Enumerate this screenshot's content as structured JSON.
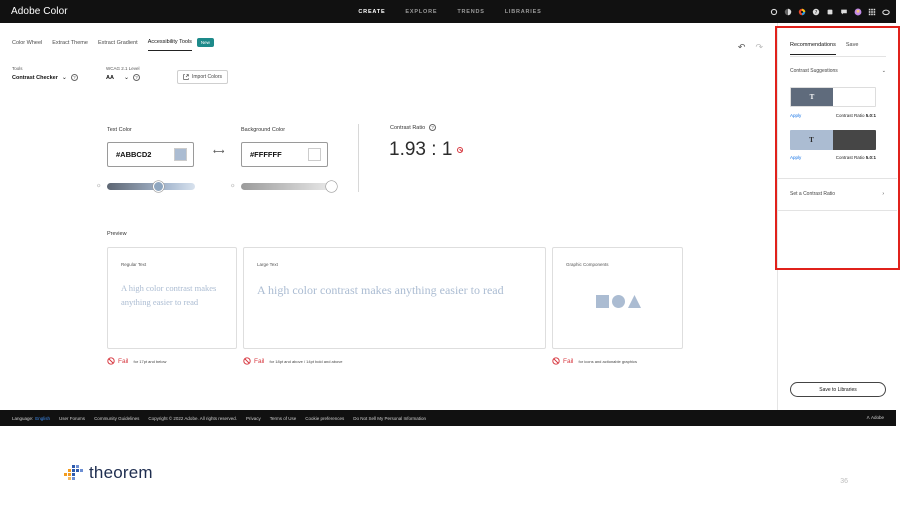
{
  "app": {
    "brand": "Adobe Color",
    "nav": [
      "CREATE",
      "EXPLORE",
      "TRENDS",
      "LIBRARIES"
    ],
    "active_nav": "CREATE"
  },
  "tabs": {
    "items": [
      "Color Wheel",
      "Extract Theme",
      "Extract Gradient",
      "Accessibility Tools"
    ],
    "active": "Accessibility Tools",
    "new_badge": "New"
  },
  "tools": {
    "label": "Tools",
    "value": "Contrast Checker",
    "wcag_label": "WCAG 2.1 Level",
    "wcag_value": "AA",
    "import_label": "Import Colors"
  },
  "contrast": {
    "text_color_label": "Text Color",
    "text_color_hex": "#ABBCD2",
    "text_color": "#abbcd2",
    "bg_color_label": "Background Color",
    "bg_color_hex": "#FFFFFF",
    "bg_color": "#ffffff",
    "ratio_label": "Contrast Ratio",
    "ratio_value": "1.93 : 1",
    "text_slider_fraction": 0.58,
    "bg_slider_fraction": 1.0
  },
  "preview": {
    "label": "Preview",
    "cards": [
      {
        "title": "Regular Text",
        "text": "A high color contrast makes anything easier to read",
        "fail": "Fail",
        "note": "for 17pt and below"
      },
      {
        "title": "Large Text",
        "text": "A high color contrast makes anything easier to read",
        "fail": "Fail",
        "note": "for 18pt and above / 14pt bold and above"
      },
      {
        "title": "Graphic Components",
        "text": "",
        "fail": "Fail",
        "note": "for icons and actionable graphics"
      }
    ]
  },
  "panel": {
    "tabs": [
      "Recommendations",
      "Save"
    ],
    "active_tab": "Recommendations",
    "suggestions_label": "Contrast Suggestions",
    "suggestions": [
      {
        "left_bg": "#5f6b7c",
        "left_fg": "#ffffff",
        "right_bg": "#ffffff",
        "glyph": "T",
        "apply": "Apply",
        "ratio_label": "Contrast Ratio",
        "ratio": "5.0:1"
      },
      {
        "left_bg": "#abbcd2",
        "left_fg": "#2c2c2c",
        "right_bg": "#464646",
        "glyph": "T",
        "apply": "Apply",
        "ratio_label": "Contrast Ratio",
        "ratio": "5.0:1"
      }
    ],
    "set_ratio_label": "Set a Contrast Ratio",
    "save_button": "Save to Libraries"
  },
  "footer": {
    "language_label": "Language:",
    "language_value": "English",
    "links": [
      "User Forums",
      "Community Guidelines",
      "Copyright © 2022 Adobe. All rights reserved.",
      "Privacy",
      "Terms of Use",
      "Cookie preferences",
      "Do Not Sell My Personal Information"
    ],
    "adobe": "Adobe"
  },
  "slide": {
    "logo_text": "theorem",
    "page_number": "36"
  }
}
